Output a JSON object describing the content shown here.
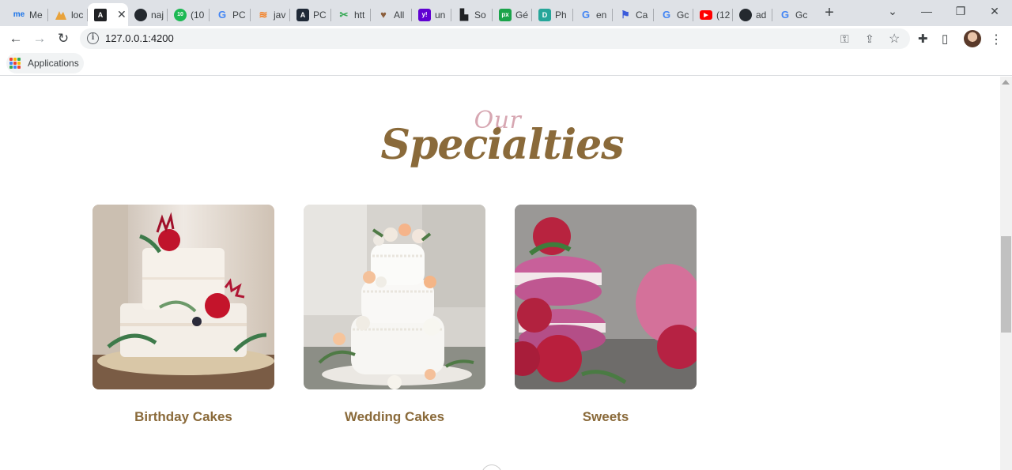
{
  "browser": {
    "tabs": [
      {
        "fav_text": "me",
        "fav_color": "#1a73e8",
        "label": "Me"
      },
      {
        "fav_text": "",
        "fav_color": "#e8710a",
        "label": "loc"
      },
      {
        "fav_text": "A",
        "fav_color": "#202124",
        "label": ""
      },
      {
        "fav_text": "",
        "fav_color": "#24292f",
        "label": "naj"
      },
      {
        "fav_text": "10",
        "fav_color": "#1db954",
        "label": "(10"
      },
      {
        "fav_text": "G",
        "fav_color": "#4285f4",
        "label": "PC"
      },
      {
        "fav_text": "",
        "fav_color": "#f48024",
        "label": "jav"
      },
      {
        "fav_text": "A",
        "fav_color": "#1f2937",
        "label": "PC"
      },
      {
        "fav_text": "",
        "fav_color": "#34a853",
        "label": "htt"
      },
      {
        "fav_text": "",
        "fav_color": "#8b5e3c",
        "label": "All"
      },
      {
        "fav_text": "y!",
        "fav_color": "#6001d2",
        "label": "un"
      },
      {
        "fav_text": "",
        "fav_color": "#202124",
        "label": "So"
      },
      {
        "fav_text": "px",
        "fav_color": "#1aa34a",
        "label": "Gé"
      },
      {
        "fav_text": "D",
        "fav_color": "#26a69a",
        "label": "Ph"
      },
      {
        "fav_text": "G",
        "fav_color": "#4285f4",
        "label": "en"
      },
      {
        "fav_text": "",
        "fav_color": "#3b5bdb",
        "label": "Ca"
      },
      {
        "fav_text": "G",
        "fav_color": "#4285f4",
        "label": "Gc"
      },
      {
        "fav_text": "",
        "fav_color": "#ff0000",
        "label": "(12"
      },
      {
        "fav_text": "",
        "fav_color": "#24292f",
        "label": "ad"
      },
      {
        "fav_text": "G",
        "fav_color": "#4285f4",
        "label": "Gc"
      }
    ],
    "new_tab_icon": "+",
    "tab_search_icon": "⌄",
    "minimize_icon": "—",
    "restore_icon": "❐",
    "close_icon": "✕",
    "back_icon": "←",
    "forward_icon": "→",
    "reload_icon": "↻",
    "url": "127.0.0.1:4200",
    "info_icon": "i",
    "key_icon": "⚿",
    "share_icon": "⇪",
    "star_icon": "☆",
    "extensions_icon": "✚",
    "sidepanel_icon": "▯",
    "menu_icon": "⋮",
    "bookmarks": {
      "apps_label": "Applications"
    }
  },
  "page": {
    "heading_small": "Our",
    "heading_big": "Specialties",
    "cards": [
      {
        "caption": "Birthday Cakes"
      },
      {
        "caption": "Wedding Cakes"
      },
      {
        "caption": "Sweets"
      }
    ]
  },
  "colors": {
    "accent_brown": "#8a6a3a",
    "accent_pink": "#d7a7b2"
  }
}
